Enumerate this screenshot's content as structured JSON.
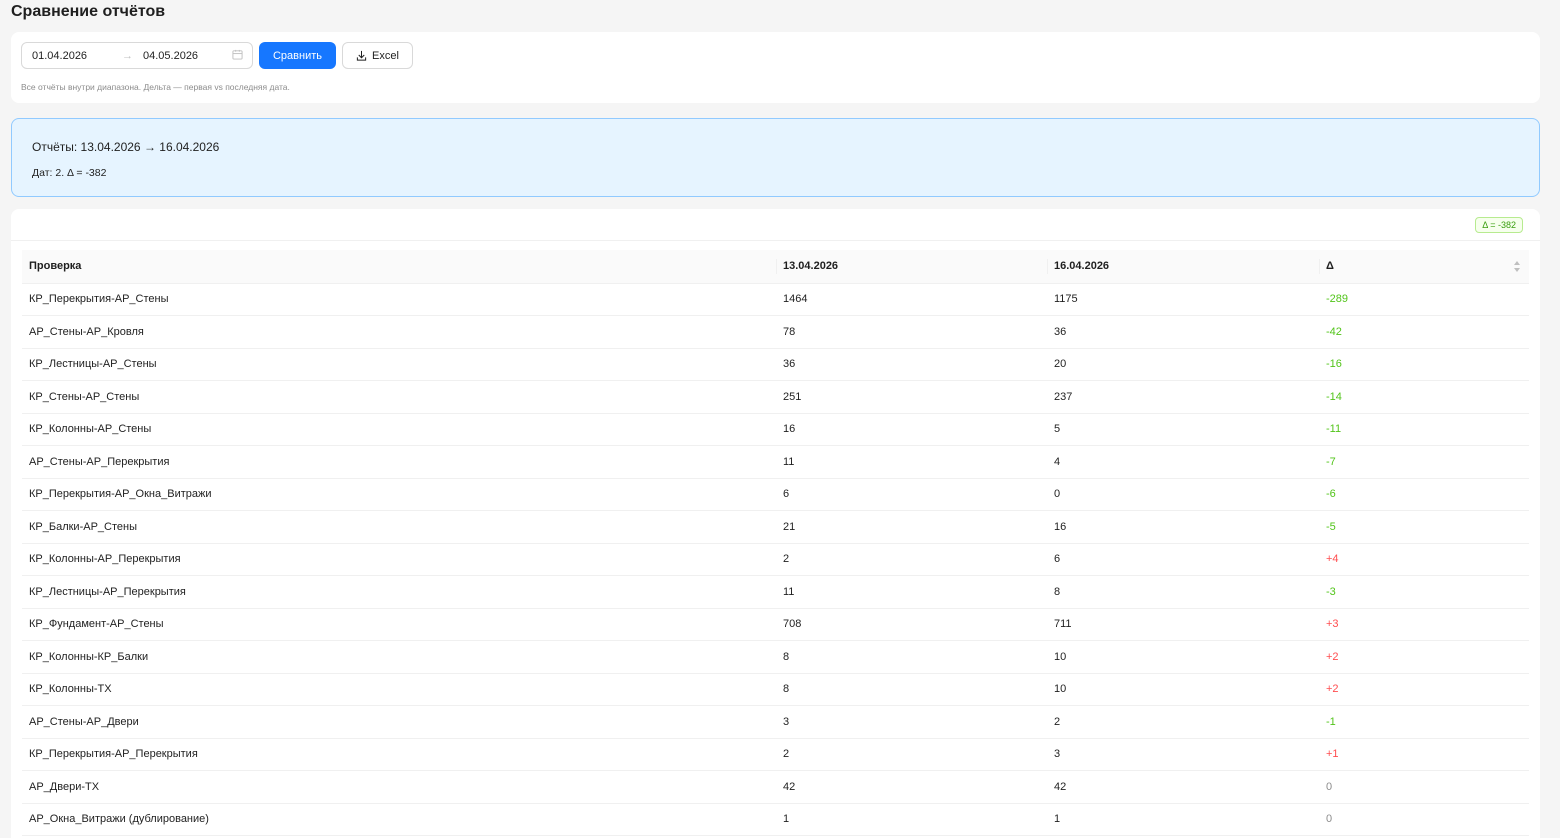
{
  "page": {
    "title": "Сравнение отчётов"
  },
  "filter": {
    "date_from": "01.04.2026",
    "arrow": "→",
    "date_to": "04.05.2026",
    "compare_label": "Сравнить",
    "excel_label": "Excel",
    "hint": "Все отчёты внутри диапазона. Дельта — первая vs последняя дата."
  },
  "info": {
    "title": "Отчёты: 13.04.2026 → 16.04.2026",
    "subtitle": "Дат: 2. Δ = -382"
  },
  "summary": {
    "delta_tag": "Δ = -382"
  },
  "table": {
    "headers": [
      "Проверка",
      "13.04.2026",
      "16.04.2026",
      "Δ"
    ],
    "rows": [
      {
        "name": "КР_Перекрытия-АР_Стены",
        "a": "1464",
        "b": "1175",
        "delta": "-289",
        "sign": "neg"
      },
      {
        "name": "АР_Стены-АР_Кровля",
        "a": "78",
        "b": "36",
        "delta": "-42",
        "sign": "neg"
      },
      {
        "name": "КР_Лестницы-АР_Стены",
        "a": "36",
        "b": "20",
        "delta": "-16",
        "sign": "neg"
      },
      {
        "name": "КР_Стены-АР_Стены",
        "a": "251",
        "b": "237",
        "delta": "-14",
        "sign": "neg"
      },
      {
        "name": "КР_Колонны-АР_Стены",
        "a": "16",
        "b": "5",
        "delta": "-11",
        "sign": "neg"
      },
      {
        "name": "АР_Стены-АР_Перекрытия",
        "a": "11",
        "b": "4",
        "delta": "-7",
        "sign": "neg"
      },
      {
        "name": "КР_Перекрытия-АР_Окна_Витражи",
        "a": "6",
        "b": "0",
        "delta": "-6",
        "sign": "neg"
      },
      {
        "name": "КР_Балки-АР_Стены",
        "a": "21",
        "b": "16",
        "delta": "-5",
        "sign": "neg"
      },
      {
        "name": "КР_Колонны-АР_Перекрытия",
        "a": "2",
        "b": "6",
        "delta": "+4",
        "sign": "pos"
      },
      {
        "name": "КР_Лестницы-АР_Перекрытия",
        "a": "11",
        "b": "8",
        "delta": "-3",
        "sign": "neg"
      },
      {
        "name": "КР_Фундамент-АР_Стены",
        "a": "708",
        "b": "711",
        "delta": "+3",
        "sign": "pos"
      },
      {
        "name": "КР_Колонны-КР_Балки",
        "a": "8",
        "b": "10",
        "delta": "+2",
        "sign": "pos"
      },
      {
        "name": "КР_Колонны-ТХ",
        "a": "8",
        "b": "10",
        "delta": "+2",
        "sign": "pos"
      },
      {
        "name": "АР_Стены-АР_Двери",
        "a": "3",
        "b": "2",
        "delta": "-1",
        "sign": "neg"
      },
      {
        "name": "КР_Перекрытия-АР_Перекрытия",
        "a": "2",
        "b": "3",
        "delta": "+1",
        "sign": "pos"
      },
      {
        "name": "АР_Двери-ТХ",
        "a": "42",
        "b": "42",
        "delta": "0",
        "sign": "zero"
      },
      {
        "name": "АР_Окна_Витражи (дублирование)",
        "a": "1",
        "b": "1",
        "delta": "0",
        "sign": "zero"
      }
    ]
  },
  "colors": {
    "primary": "#1677ff",
    "delta_negative": "#52c41a",
    "delta_positive": "#ff4d4f",
    "info_bg": "#e6f4ff",
    "info_border": "#91caff"
  },
  "icons": {
    "calendar": "calendar-icon",
    "download": "download-icon",
    "sort": "sort-icon"
  }
}
